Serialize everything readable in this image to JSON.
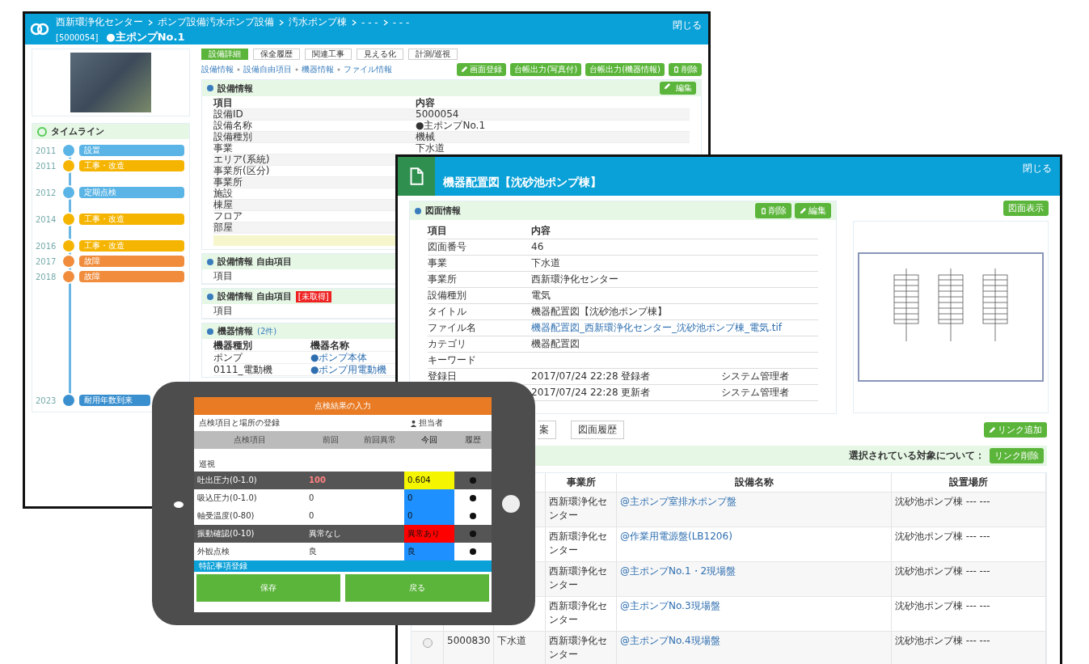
{
  "back_window": {
    "breadcrumb": [
      "西新環浄化センター",
      "ポンプ設備汚水ポンプ設備",
      "汚水ポンプ棟",
      "- - -",
      "- - -"
    ],
    "equipment_id": "[5000054]",
    "title": "●主ポンプNo.1",
    "close": "閉じる",
    "tabs": [
      {
        "label": "設備詳細",
        "selected": true
      },
      {
        "label": "保全履歴",
        "selected": false
      },
      {
        "label": "関連工事",
        "selected": false
      },
      {
        "label": "見える化",
        "selected": false
      },
      {
        "label": "計測/巡視",
        "selected": false
      }
    ],
    "sublinks": [
      "設備情報",
      "設備自由項目",
      "機器情報",
      "ファイル情報"
    ],
    "actions": [
      {
        "label": "画面登録",
        "kind": "edit"
      },
      {
        "label": "台帳出力(写真付)",
        "kind": "plain"
      },
      {
        "label": "台帳出力(機器情報)",
        "kind": "plain"
      },
      {
        "label": "削除",
        "kind": "delete"
      }
    ],
    "timeline": {
      "title": "タイムライン",
      "items": [
        {
          "year": "2011",
          "label": "設置",
          "color": "#5ab4e5"
        },
        {
          "year": "2011",
          "label": "工事・改造",
          "color": "#f5b400"
        },
        {
          "year": "2012",
          "label": "定期点検",
          "color": "#5ab4e5"
        },
        {
          "year": "2014",
          "label": "工事・改造",
          "color": "#f5b400"
        },
        {
          "year": "2016",
          "label": "工事・改造",
          "color": "#f5b400"
        },
        {
          "year": "2017",
          "label": "故障",
          "color": "#f08c3c"
        },
        {
          "year": "2018",
          "label": "故障",
          "color": "#f08c3c"
        },
        {
          "year": "2023",
          "label": "耐用年数到来",
          "color": "#3a8fcf"
        }
      ]
    },
    "info": {
      "title": "設備情報",
      "edit": "編集",
      "columns": [
        "項目",
        "内容"
      ],
      "rows": [
        {
          "label": "設備ID",
          "value": "5000054"
        },
        {
          "label": "設備名称",
          "value": "●主ポンプNo.1"
        },
        {
          "label": "設備種別",
          "value": "機械"
        },
        {
          "label": "事業",
          "value": "下水道"
        },
        {
          "label": "エリア(系統)"
        },
        {
          "label": "事業所(区分)"
        },
        {
          "label": "事業所"
        },
        {
          "label": "施設"
        },
        {
          "label": "棟屋"
        },
        {
          "label": "フロア"
        },
        {
          "label": "部屋"
        }
      ]
    },
    "free_items": {
      "title": "設備情報 自由項目",
      "row": "項目"
    },
    "free_items2": {
      "title": "設備情報 自由項目",
      "tag": "[未取得]",
      "row": "項目"
    },
    "devices": {
      "title": "機器情報",
      "count": "(2件)",
      "columns": [
        "機器種別",
        "機器名称"
      ],
      "rows": [
        [
          "ポンプ",
          "●ポンプ本体"
        ],
        [
          "0111_電動機",
          "●ポンプ用電動機"
        ]
      ]
    }
  },
  "front_window": {
    "title": "機器配置図【沈砂池ポンプ棟】",
    "close": "閉じる",
    "section": {
      "title": "図面情報",
      "delete": "削除",
      "edit": "編集",
      "columns": [
        "項目",
        "内容"
      ],
      "rows": [
        {
          "label": "図面番号",
          "value": "46"
        },
        {
          "label": "事業",
          "value": "下水道"
        },
        {
          "label": "事業所",
          "value": "西新環浄化センター"
        },
        {
          "label": "設備種別",
          "value": "電気"
        },
        {
          "label": "タイトル",
          "value": "機器配置図【沈砂池ポンプ棟】"
        },
        {
          "label": "ファイル名",
          "value": "機器配置図_西新環浄化センター_沈砂池ポンプ棟_電気.tif",
          "link": true
        },
        {
          "label": "カテゴリ",
          "value": "機器配置図"
        },
        {
          "label": "キーワード"
        },
        {
          "label": "登録日",
          "value": "2017/07/24 22:28 登録者",
          "user": "システム管理者"
        },
        {
          "value": "2017/07/24 22:28 更新者",
          "user": "システム管理者"
        }
      ]
    },
    "show_drawing": "図面表示",
    "tabs": [
      "案",
      "図面履歴"
    ],
    "add_link": "リンク追加",
    "selection_label": "選択されている対象について：",
    "remove_link": "リンク削除",
    "table": {
      "columns": [
        "事業所",
        "設備名称",
        "設置場所"
      ],
      "rows": [
        {
          "office": "西新環浄化センター",
          "name": "@主ポンプ室排水ポンプ盤",
          "place": "沈砂池ポンプ棟 ‐‐‐ ‐‐‐"
        },
        {
          "office": "西新環浄化センター",
          "name": "@作業用電源盤(LB1206)",
          "place": "沈砂池ポンプ棟 ‐‐‐ ‐‐‐"
        },
        {
          "office": "西新環浄化センター",
          "name": "@主ポンプNo.1・2現場盤",
          "place": "沈砂池ポンプ棟 ‐‐‐ ‐‐‐"
        },
        {
          "office": "西新環浄化センター",
          "name": "@主ポンプNo.3現場盤",
          "place": "沈砂池ポンプ棟 ‐‐‐ ‐‐‐"
        },
        {
          "selected": false,
          "id": "5000830",
          "business": "下水道",
          "office": "西新環浄化センター",
          "name": "@主ポンプNo.4現場盤",
          "place": "沈砂池ポンプ棟 ‐‐‐ ‐‐‐"
        }
      ]
    }
  },
  "tablet": {
    "title": "点検結果の入力",
    "subject": "点検項目と場所の登録",
    "user": "担当者",
    "columns": [
      "点検項目",
      "前回",
      "前回異常",
      "今回",
      "履歴"
    ],
    "group": "巡視",
    "rows": [
      {
        "item": "吐出圧力(0-1.0)",
        "previous": "100",
        "alert": true,
        "shaded": true,
        "today": "0.604",
        "color": "#f5f500"
      },
      {
        "item": "吸込圧力(0-1.0)",
        "previous": "0",
        "alert": false,
        "shaded": false,
        "today": "0",
        "color": "#1e90ff"
      },
      {
        "item": "軸受温度(0-80)",
        "previous": "0",
        "alert": false,
        "shaded": false,
        "today": "0",
        "color": "#1e90ff"
      },
      {
        "item": "振動確認(0-10)",
        "previous": "異常なし",
        "alert": false,
        "shaded": true,
        "today": "異常あり",
        "color": "#ff0000"
      },
      {
        "item": "外観点検",
        "previous": "良",
        "alert": false,
        "shaded": false,
        "today": "良",
        "color": "#1e90ff"
      }
    ],
    "notes": "特記事項登録",
    "buttons": [
      "保存",
      "戻る"
    ]
  }
}
